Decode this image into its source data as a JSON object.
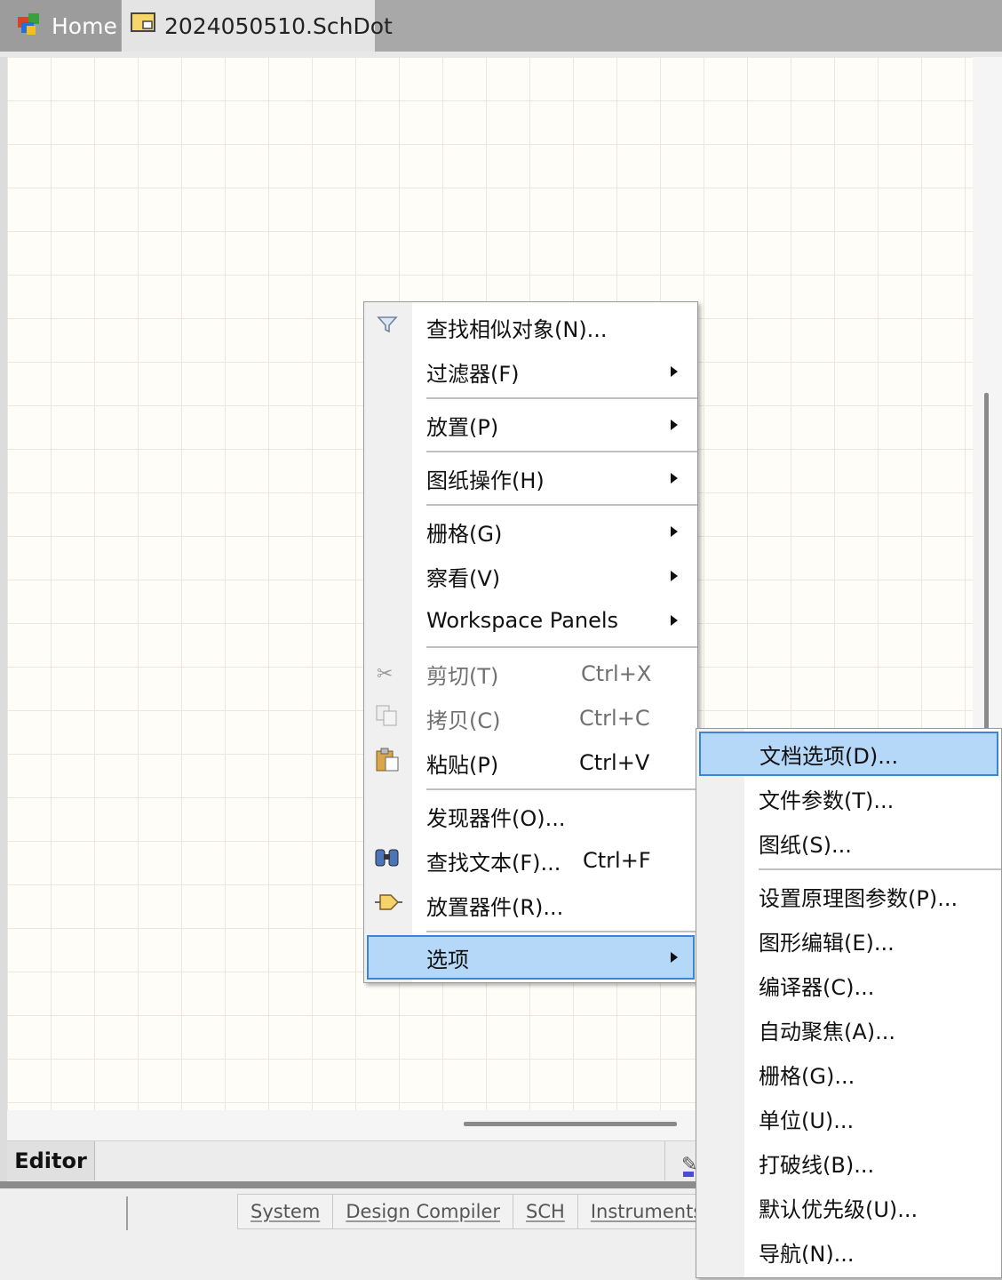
{
  "tabs": [
    {
      "label": "Home"
    },
    {
      "label": "2024050510.SchDot"
    }
  ],
  "editor": {
    "tab_label": "Editor"
  },
  "status": {
    "panel_buttons": [
      "System",
      "Design Compiler",
      "SCH",
      "Instruments"
    ]
  },
  "context_menu": {
    "items": [
      {
        "label": "查找相似对象(N)...",
        "icon": "funnel-icon"
      },
      {
        "label": "过滤器(F)",
        "submenu": true
      },
      {
        "label": "放置(P)",
        "submenu": true
      },
      {
        "label": "图纸操作(H)",
        "submenu": true
      },
      {
        "label": "栅格(G)",
        "submenu": true
      },
      {
        "label": "察看(V)",
        "submenu": true
      },
      {
        "label": "Workspace Panels",
        "submenu": true
      },
      {
        "label": "剪切(T)",
        "shortcut": "Ctrl+X",
        "disabled": true,
        "icon": "scissors-icon"
      },
      {
        "label": "拷贝(C)",
        "shortcut": "Ctrl+C",
        "disabled": true,
        "icon": "copy-icon"
      },
      {
        "label": "粘贴(P)",
        "shortcut": "Ctrl+V",
        "icon": "paste-icon"
      },
      {
        "label": "发现器件(O)..."
      },
      {
        "label": "查找文本(F)...",
        "shortcut": "Ctrl+F",
        "icon": "binoculars-icon"
      },
      {
        "label": "放置器件(R)...",
        "icon": "place-part-icon"
      },
      {
        "label": "选项",
        "submenu": true,
        "selected": true
      }
    ]
  },
  "options_submenu": {
    "items": [
      {
        "label": "文档选项(D)...",
        "selected": true
      },
      {
        "label": "文件参数(T)..."
      },
      {
        "label": "图纸(S)..."
      },
      {
        "label": "设置原理图参数(P)..."
      },
      {
        "label": "图形编辑(E)..."
      },
      {
        "label": "编译器(C)..."
      },
      {
        "label": "自动聚焦(A)..."
      },
      {
        "label": "栅格(G)..."
      },
      {
        "label": "单位(U)..."
      },
      {
        "label": "打破线(B)..."
      },
      {
        "label": "默认优先级(U)..."
      },
      {
        "label": "导航(N)..."
      }
    ]
  },
  "colors": {
    "selection_fill": "#b5d7f8",
    "selection_border": "#3a86d6",
    "canvas_bg": "#fffdf7",
    "grid_line": "#ebe7dc"
  }
}
